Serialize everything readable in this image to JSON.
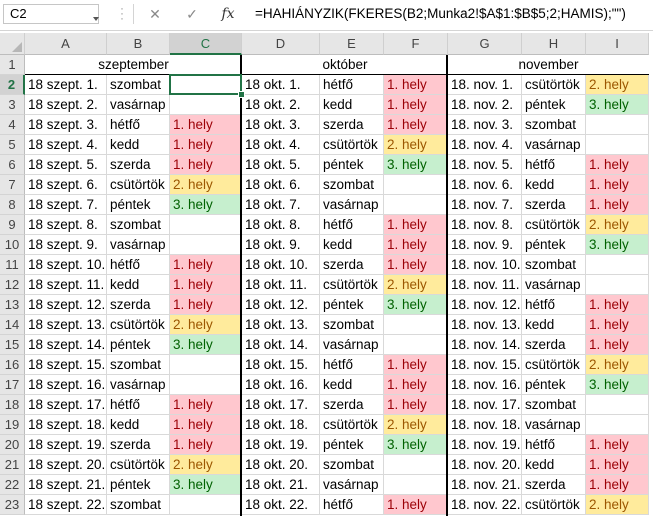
{
  "formula_bar": {
    "name_box": "C2",
    "cancel_icon": "✕",
    "confirm_icon": "✓",
    "fx_label": "fx",
    "formula": "=HAHIÁNYZIK(FKERES(B2;Munka2!$A$1:$B$5;2;HAMIS);\"\")"
  },
  "columns": [
    "A",
    "B",
    "C",
    "D",
    "E",
    "F",
    "G",
    "H",
    "I"
  ],
  "selected_column": "C",
  "selected_row": 2,
  "months": [
    "szeptember",
    "október",
    "november"
  ],
  "rows": [
    {
      "n": 1
    },
    {
      "n": 2,
      "A": "18 szept. 1.",
      "B": "szombat",
      "C": "",
      "D": "18 okt. 1.",
      "E": "hétfő",
      "F": "1. hely",
      "G": "18. nov. 1.",
      "H": "csütörtök",
      "I": "2. hely"
    },
    {
      "n": 3,
      "A": "18 szept. 2.",
      "B": "vasárnap",
      "C": "",
      "D": "18 okt. 2.",
      "E": "kedd",
      "F": "1. hely",
      "G": "18. nov. 2.",
      "H": "péntek",
      "I": "3. hely"
    },
    {
      "n": 4,
      "A": "18 szept. 3.",
      "B": "hétfő",
      "C": "1. hely",
      "D": "18 okt. 3.",
      "E": "szerda",
      "F": "1. hely",
      "G": "18. nov. 3.",
      "H": "szombat",
      "I": ""
    },
    {
      "n": 5,
      "A": "18 szept. 4.",
      "B": "kedd",
      "C": "1. hely",
      "D": "18 okt. 4.",
      "E": "csütörtök",
      "F": "2. hely",
      "G": "18. nov. 4.",
      "H": "vasárnap",
      "I": ""
    },
    {
      "n": 6,
      "A": "18 szept. 5.",
      "B": "szerda",
      "C": "1. hely",
      "D": "18 okt. 5.",
      "E": "péntek",
      "F": "3. hely",
      "G": "18. nov. 5.",
      "H": "hétfő",
      "I": "1. hely"
    },
    {
      "n": 7,
      "A": "18 szept. 6.",
      "B": "csütörtök",
      "C": "2. hely",
      "D": "18 okt. 6.",
      "E": "szombat",
      "F": "",
      "G": "18. nov. 6.",
      "H": "kedd",
      "I": "1. hely"
    },
    {
      "n": 8,
      "A": "18 szept. 7.",
      "B": "péntek",
      "C": "3. hely",
      "D": "18 okt. 7.",
      "E": "vasárnap",
      "F": "",
      "G": "18. nov. 7.",
      "H": "szerda",
      "I": "1. hely"
    },
    {
      "n": 9,
      "A": "18 szept. 8.",
      "B": "szombat",
      "C": "",
      "D": "18 okt. 8.",
      "E": "hétfő",
      "F": "1. hely",
      "G": "18. nov. 8.",
      "H": "csütörtök",
      "I": "2. hely"
    },
    {
      "n": 10,
      "A": "18 szept. 9.",
      "B": "vasárnap",
      "C": "",
      "D": "18 okt. 9.",
      "E": "kedd",
      "F": "1. hely",
      "G": "18. nov. 9.",
      "H": "péntek",
      "I": "3. hely"
    },
    {
      "n": 11,
      "A": "18 szept. 10.",
      "B": "hétfő",
      "C": "1. hely",
      "D": "18 okt. 10.",
      "E": "szerda",
      "F": "1. hely",
      "G": "18. nov. 10.",
      "H": "szombat",
      "I": ""
    },
    {
      "n": 12,
      "A": "18 szept. 11.",
      "B": "kedd",
      "C": "1. hely",
      "D": "18 okt. 11.",
      "E": "csütörtök",
      "F": "2. hely",
      "G": "18. nov. 11.",
      "H": "vasárnap",
      "I": ""
    },
    {
      "n": 13,
      "A": "18 szept. 12.",
      "B": "szerda",
      "C": "1. hely",
      "D": "18 okt. 12.",
      "E": "péntek",
      "F": "3. hely",
      "G": "18. nov. 12.",
      "H": "hétfő",
      "I": "1. hely"
    },
    {
      "n": 14,
      "A": "18 szept. 13.",
      "B": "csütörtök",
      "C": "2. hely",
      "D": "18 okt. 13.",
      "E": "szombat",
      "F": "",
      "G": "18. nov. 13.",
      "H": "kedd",
      "I": "1. hely"
    },
    {
      "n": 15,
      "A": "18 szept. 14.",
      "B": "péntek",
      "C": "3. hely",
      "D": "18 okt. 14.",
      "E": "vasárnap",
      "F": "",
      "G": "18. nov. 14.",
      "H": "szerda",
      "I": "1. hely"
    },
    {
      "n": 16,
      "A": "18 szept. 15.",
      "B": "szombat",
      "C": "",
      "D": "18 okt. 15.",
      "E": "hétfő",
      "F": "1. hely",
      "G": "18. nov. 15.",
      "H": "csütörtök",
      "I": "2. hely"
    },
    {
      "n": 17,
      "A": "18 szept. 16.",
      "B": "vasárnap",
      "C": "",
      "D": "18 okt. 16.",
      "E": "kedd",
      "F": "1. hely",
      "G": "18. nov. 16.",
      "H": "péntek",
      "I": "3. hely"
    },
    {
      "n": 18,
      "A": "18 szept. 17.",
      "B": "hétfő",
      "C": "1. hely",
      "D": "18 okt. 17.",
      "E": "szerda",
      "F": "1. hely",
      "G": "18. nov. 17.",
      "H": "szombat",
      "I": ""
    },
    {
      "n": 19,
      "A": "18 szept. 18.",
      "B": "kedd",
      "C": "1. hely",
      "D": "18 okt. 18.",
      "E": "csütörtök",
      "F": "2. hely",
      "G": "18. nov. 18.",
      "H": "vasárnap",
      "I": ""
    },
    {
      "n": 20,
      "A": "18 szept. 19.",
      "B": "szerda",
      "C": "1. hely",
      "D": "18 okt. 19.",
      "E": "péntek",
      "F": "3. hely",
      "G": "18. nov. 19.",
      "H": "hétfő",
      "I": "1. hely"
    },
    {
      "n": 21,
      "A": "18 szept. 20.",
      "B": "csütörtök",
      "C": "2. hely",
      "D": "18 okt. 20.",
      "E": "szombat",
      "F": "",
      "G": "18. nov. 20.",
      "H": "kedd",
      "I": "1. hely"
    },
    {
      "n": 22,
      "A": "18 szept. 21.",
      "B": "péntek",
      "C": "3. hely",
      "D": "18 okt. 21.",
      "E": "vasárnap",
      "F": "",
      "G": "18. nov. 21.",
      "H": "szerda",
      "I": "1. hely"
    },
    {
      "n": 23,
      "A": "18 szept. 22.",
      "B": "szombat",
      "C": "",
      "D": "18 okt. 22.",
      "E": "hétfő",
      "F": "1. hely",
      "G": "18. nov. 22.",
      "H": "csütörtök",
      "I": "2. hely"
    }
  ],
  "place_colors": {
    "1. hely": "red",
    "2. hely": "yellow",
    "3. hely": "green"
  }
}
